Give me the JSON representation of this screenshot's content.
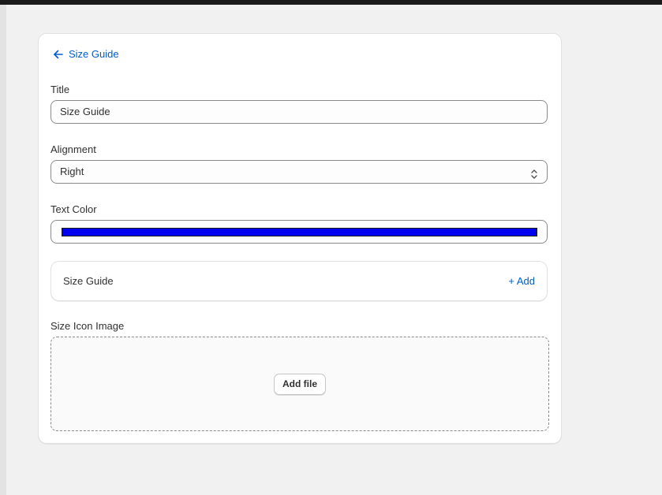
{
  "back_link": {
    "label": "Size Guide",
    "icon": "arrow-left-icon"
  },
  "fields": {
    "title": {
      "label": "Title",
      "value": "Size Guide"
    },
    "alignment": {
      "label": "Alignment",
      "value": "Right",
      "icon": "chevron-up-down-icon"
    },
    "text_color": {
      "label": "Text Color",
      "value": "#0000ee"
    }
  },
  "size_guide_block": {
    "title": "Size Guide",
    "add_label": "+ Add"
  },
  "size_icon_image": {
    "label": "Size Icon Image",
    "button_label": "Add file"
  },
  "colors": {
    "link": "#005bd3",
    "page_bg": "#f1f1f1",
    "card_bg": "#ffffff"
  }
}
